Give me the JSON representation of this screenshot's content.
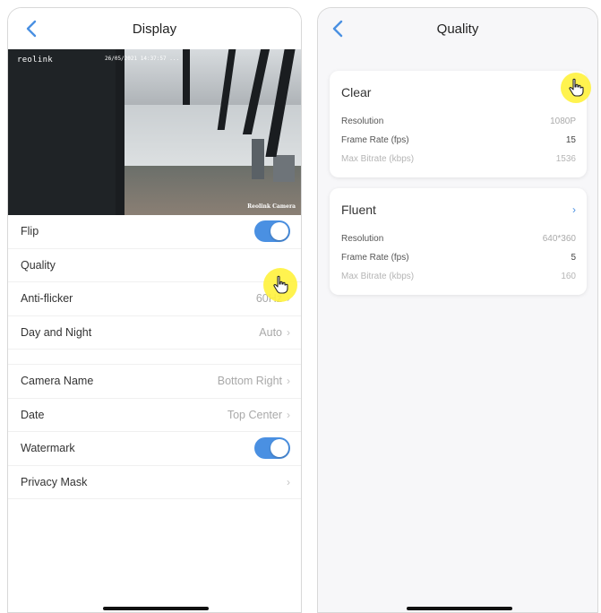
{
  "display": {
    "title": "Display",
    "preview": {
      "brand": "reolink",
      "timestamp": "26/05/2021 14:37:57 ...",
      "camera_label": "Reolink Camera"
    },
    "rows": [
      {
        "label": "Flip",
        "type": "toggle",
        "on": true
      },
      {
        "label": "Quality",
        "type": "link",
        "value": ""
      },
      {
        "label": "Anti-flicker",
        "type": "link",
        "value": "60Hz"
      },
      {
        "label": "Day and Night",
        "type": "link",
        "value": "Auto"
      },
      {
        "label": "Camera Name",
        "type": "link",
        "value": "Bottom Right"
      },
      {
        "label": "Date",
        "type": "link",
        "value": "Top Center"
      },
      {
        "label": "Watermark",
        "type": "toggle",
        "on": true
      },
      {
        "label": "Privacy Mask",
        "type": "link",
        "value": ""
      }
    ],
    "chevron": "›"
  },
  "quality": {
    "title": "Quality",
    "cards": [
      {
        "name": "Clear",
        "specs": [
          {
            "label": "Resolution",
            "value": "1080P"
          },
          {
            "label": "Frame Rate (fps)",
            "value": "15"
          },
          {
            "label": "Max Bitrate (kbps)",
            "value": "1536"
          }
        ]
      },
      {
        "name": "Fluent",
        "specs": [
          {
            "label": "Resolution",
            "value": "640*360"
          },
          {
            "label": "Frame Rate (fps)",
            "value": "5"
          },
          {
            "label": "Max Bitrate (kbps)",
            "value": "160"
          }
        ]
      }
    ]
  },
  "colors": {
    "accent": "#4a90e2",
    "cursor_highlight": "#fff23c"
  },
  "icons": {
    "back": "chevron-left-icon",
    "cursor": "hand-pointer-icon"
  }
}
